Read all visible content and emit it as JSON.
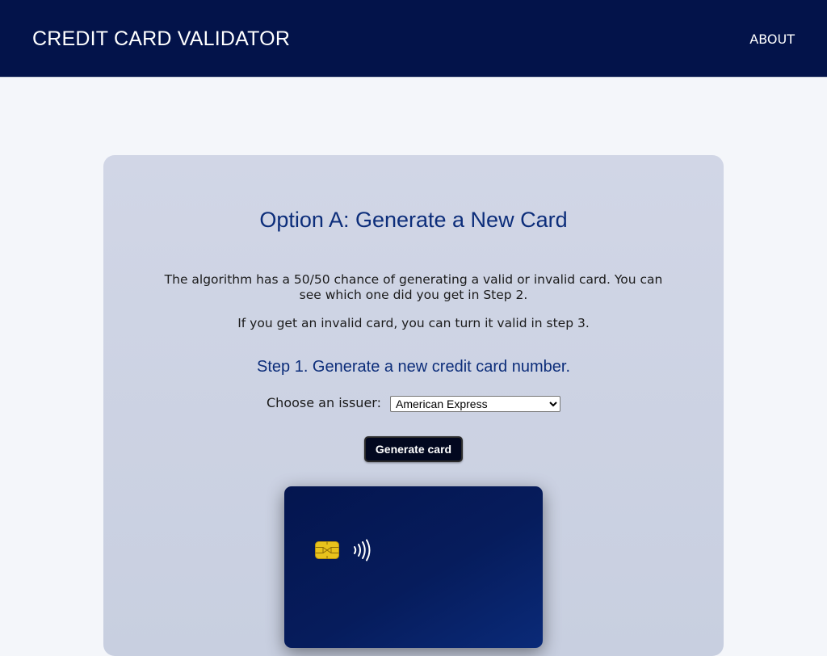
{
  "header": {
    "brand": "CREDIT CARD VALIDATOR",
    "about_link": "ABOUT"
  },
  "main": {
    "title": "Option A: Generate a New Card",
    "paragraph_1": "The algorithm has a 50/50 chance of generating a valid or invalid card. You can see which one did you get in Step 2.",
    "paragraph_2": "If you get an invalid card, you can turn it valid in step 3.",
    "step_title": "Step 1. Generate a new credit card number.",
    "issuer_label": "Choose an issuer:",
    "issuer_selected": "American Express",
    "generate_button": "Generate card"
  },
  "card": {
    "chip_icon": "chip-icon",
    "contactless_icon": "contactless-icon"
  },
  "colors": {
    "header_bg": "#03134a",
    "heading_blue": "#0c2d7a",
    "button_bg": "#02081f",
    "card_bg": "#061c5c",
    "chip_gold": "#e8c21c"
  }
}
